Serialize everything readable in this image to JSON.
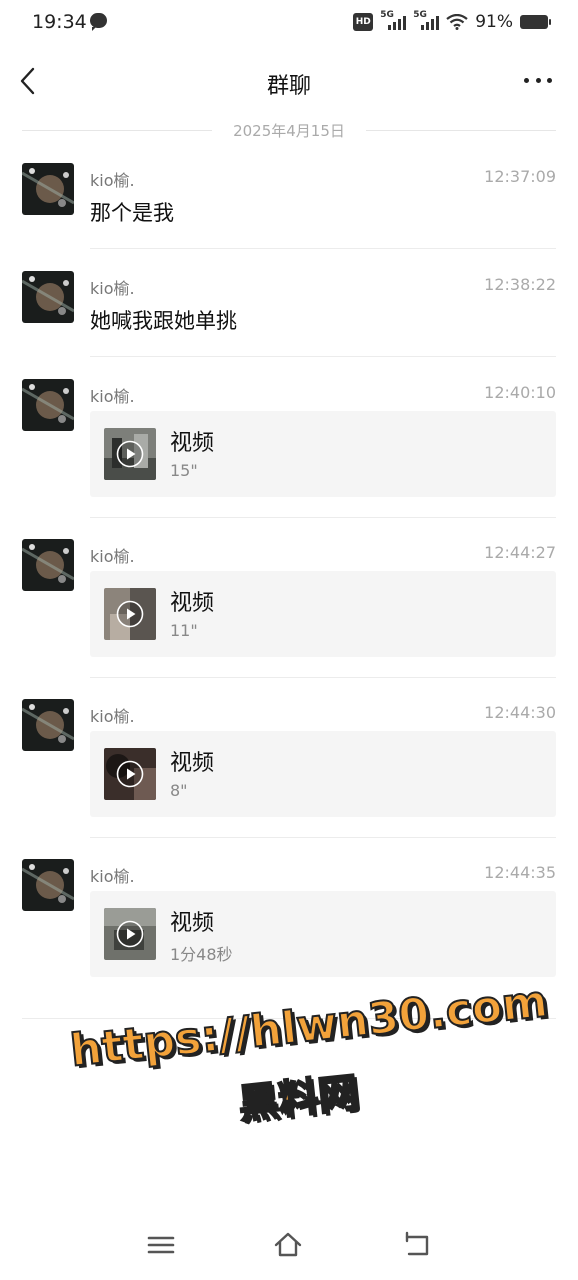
{
  "status": {
    "time": "19:34",
    "battery": "91%",
    "network_1": "5G",
    "network_2": "5G",
    "hd": "HD"
  },
  "header": {
    "title": "群聊"
  },
  "date_divider": "2025年4月15日",
  "messages": [
    {
      "sender": "kio榆.",
      "time": "12:37:09",
      "type": "text",
      "text": "那个是我"
    },
    {
      "sender": "kio榆.",
      "time": "12:38:22",
      "type": "text",
      "text": "她喊我跟她单挑"
    },
    {
      "sender": "kio榆.",
      "time": "12:40:10",
      "type": "video",
      "label": "视频",
      "duration": "15\""
    },
    {
      "sender": "kio榆.",
      "time": "12:44:27",
      "type": "video",
      "label": "视频",
      "duration": "11\""
    },
    {
      "sender": "kio榆.",
      "time": "12:44:30",
      "type": "video",
      "label": "视频",
      "duration": "8\""
    },
    {
      "sender": "kio榆.",
      "time": "12:44:35",
      "type": "video",
      "label": "视频",
      "duration": "1分48秒"
    }
  ],
  "watermark": {
    "url": "https://hlwn30.com",
    "text": "黑料网"
  },
  "icons": {
    "back": "back-arrow-icon",
    "more": "more-dots-icon",
    "play": "play-icon",
    "menu": "menu-icon",
    "home": "home-icon",
    "return": "return-icon"
  }
}
